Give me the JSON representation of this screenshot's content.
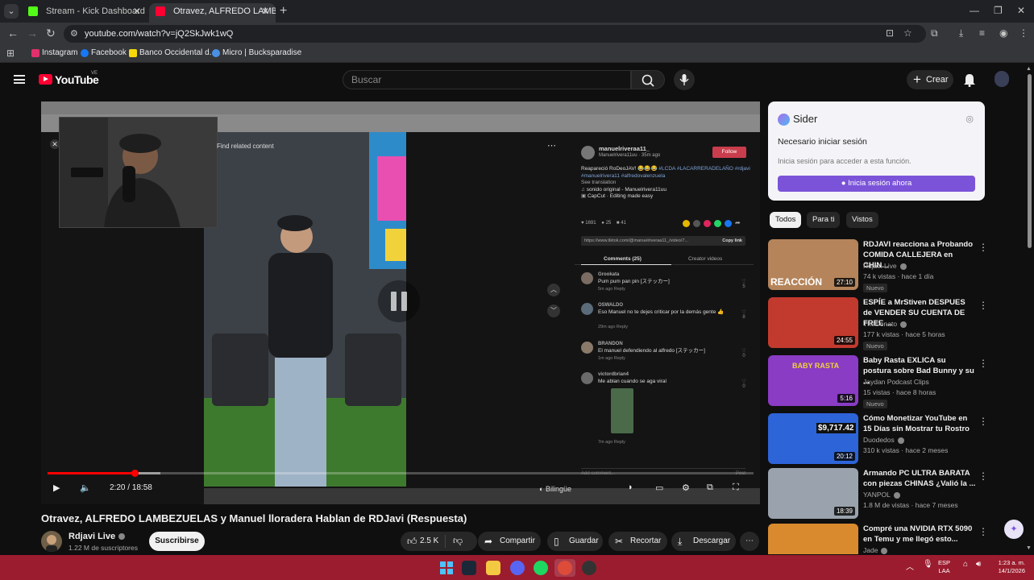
{
  "browser": {
    "tabs": [
      {
        "title": "Stream - Kick Dashboard",
        "active": false,
        "favicon_color": "#53fc18"
      },
      {
        "title": "Otravez, ALFREDO LAMBE",
        "active": true,
        "favicon_color": "#ff0033"
      }
    ],
    "url": "youtube.com/watch?v=jQ2SkJwk1wQ",
    "bookmarks": [
      {
        "label": "Instagram",
        "icon_color": "#e1306c"
      },
      {
        "label": "Facebook",
        "icon_color": "#1877f2"
      },
      {
        "label": "Banco Occidental d...",
        "icon_color": "#f5d90a"
      },
      {
        "label": "Micro | Bucksparadise",
        "icon_color": "#4a90e2"
      }
    ]
  },
  "masthead": {
    "logo": "YouTube",
    "country_code": "VE",
    "search_placeholder": "Buscar",
    "create_label": "Crear"
  },
  "player": {
    "current_time": "2:20",
    "duration": "18:58",
    "progress_fraction": 0.123,
    "buffered_fraction": 0.16,
    "bilingual_label": "Bilingüe",
    "find_related": "Find related content",
    "tiktok": {
      "username": "manuelriveraa11_",
      "subline": "Manuelrivera11uu · 35m ago",
      "follow_label": "Follow",
      "description_text": "Reapareció RoDeoJAV! 😂😂😂 ",
      "description_tags": "#LCDA #LACARRERADELAÑO #rdjavi #manuelrivera11 #alfredovalenzuela",
      "see_translation": "See translation",
      "sound": "sonido original - Manuelrivera11uu",
      "capcut": "CapCut · Editing made easy",
      "likes": "1691",
      "comments_count": "25",
      "saves": "41",
      "link": "https://www.tiktok.com/@manuelriveraa11_/video/7...",
      "copy_link": "Copy link",
      "tab_comments": "Comments (25)",
      "tab_creator": "Creator videos",
      "comments": [
        {
          "user": "Grookata",
          "text": "Pum pum pan pin [ステッカー]",
          "meta": "5m ago   Reply",
          "likes": "5"
        },
        {
          "user": "OSWALDO",
          "text": "Eso Manuel no te dejes criticar por la demás gente 👍",
          "meta": "29m ago   Reply",
          "likes": "8"
        },
        {
          "user": "BRANDON",
          "text": "El manuel defendiendo al alfredo [ステッカー]",
          "meta": "1m ago   Reply",
          "likes": "0"
        },
        {
          "user": "victordbrian4",
          "text": "Me ablan cuando se aga viral",
          "meta": "7m ago   Reply",
          "likes": "0"
        }
      ],
      "add_comment_placeholder": "Add comment...",
      "post_label": "Post"
    }
  },
  "video": {
    "title": "Otravez, ALFREDO LAMBEZUELAS y Manuel lloradera Hablan de RDJavi (Respuesta)",
    "channel": "Rdjavi Live",
    "subscribers": "1.22 M de suscriptores",
    "subscribe_label": "Suscribirse",
    "likes": "2.5 K",
    "share_label": "Compartir",
    "save_label": "Guardar",
    "clip_label": "Recortar",
    "download_label": "Descargar"
  },
  "sider": {
    "name": "Sider",
    "heading": "Necesario iniciar sesión",
    "body": "Inicia sesión para acceder a esta función.",
    "button": "Inicia sesión ahora",
    "accent": "#7b53d9"
  },
  "chips": [
    "Todos",
    "Para ti",
    "Vistos"
  ],
  "recommendations": [
    {
      "title": "RDJAVI reacciona a Probando COMIDA CALLEJERA en CHIN...",
      "channel": "Rdjavi Live",
      "verified": true,
      "meta": "74 k vistas · hace 1 día",
      "badge": "Nuevo",
      "duration": "27:10",
      "thumb_color": "#b5845a",
      "thumb_text": "REACCIÓN"
    },
    {
      "title": "ESPÍE a MrStiven DESPUES de VENDER SU CUENTA DE FREE ...",
      "channel": "TheDonato",
      "verified": true,
      "meta": "177 k vistas · hace 5 horas",
      "badge": "Nuevo",
      "duration": "24:55",
      "thumb_color": "#c23a2e",
      "thumb_text": ""
    },
    {
      "title": "Baby Rasta EXLICA su postura sobre Bad Bunny y su ...",
      "channel": "Jaydan Podcast Clips",
      "verified": false,
      "meta": "15 vistas · hace 8 horas",
      "badge": "Nuevo",
      "duration": "5:16",
      "thumb_color": "#8a3cc4",
      "thumb_text": "BABY RASTA"
    },
    {
      "title": "Cómo Monetizar YouTube en 15 Días sin Mostrar tu Rostro",
      "channel": "Duodedos",
      "verified": true,
      "meta": "310 k vistas · hace 2 meses",
      "badge": "",
      "duration": "20:12",
      "thumb_color": "#2d64d8",
      "thumb_text": "$9,717.42"
    },
    {
      "title": "Armando PC ULTRA BARATA con piezas CHINAS ¿Valió la ...",
      "channel": "YANPOL",
      "verified": true,
      "meta": "1.8 M de vistas · hace 7 meses",
      "badge": "",
      "duration": "18:39",
      "thumb_color": "#9aa3ad",
      "thumb_text": ""
    },
    {
      "title": "Compré una NVIDIA RTX 5090 en Temu y me llegó esto...",
      "channel": "Jade",
      "verified": true,
      "meta": "",
      "badge": "",
      "duration": "",
      "thumb_color": "#d98a2e",
      "thumb_text": ""
    }
  ],
  "taskbar": {
    "lang_line1": "ESP",
    "lang_line2": "LAA",
    "time": "1:23 a. m.",
    "date": "14/1/2026"
  }
}
